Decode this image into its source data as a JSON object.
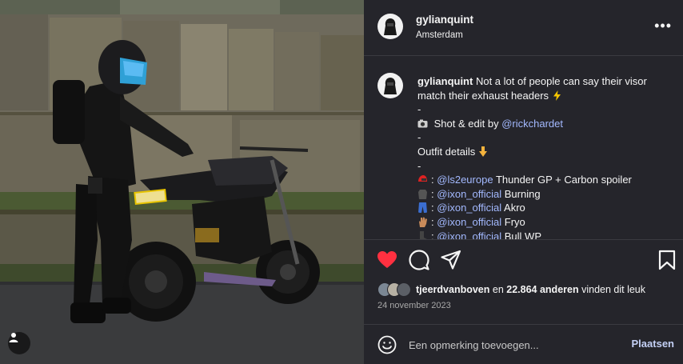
{
  "photo": {
    "user_tag_icon": "person-icon"
  },
  "header": {
    "username": "gylianquint",
    "location": "Amsterdam",
    "more_icon": "more-options-icon",
    "more_glyph": "•••"
  },
  "caption": {
    "username": "gylianquint",
    "text": "Not a lot of people can say their visor match their exhaust headers",
    "dash1": "-",
    "shot_text": "Shot & edit by",
    "shot_mention": "@rickchardet",
    "dash2": "-",
    "outfit_text": "Outfit details",
    "dash3": "-",
    "items": [
      {
        "sep": ":",
        "mention": "@ls2europe",
        "text": "Thunder GP + Carbon spoiler"
      },
      {
        "sep": ":",
        "mention": "@ixon_official",
        "text": "Burning"
      },
      {
        "sep": ":",
        "mention": "@ixon_official",
        "text": "Akro"
      },
      {
        "sep": ":",
        "mention": "@ixon_official",
        "text": "Fryo"
      },
      {
        "sep": ":",
        "mention": "@ixon_official",
        "text": "Bull WP"
      }
    ]
  },
  "actions": {
    "like_icon": "heart-icon",
    "comment_icon": "comment-icon",
    "share_icon": "share-icon",
    "save_icon": "bookmark-icon",
    "like_color": "#ff3040"
  },
  "likes": {
    "first_user": "tjeerdvanboven",
    "connector": "en",
    "others": "22.864 anderen",
    "suffix": "vinden dit leuk"
  },
  "date": "24 november 2023",
  "comment": {
    "emoji_icon": "emoji-icon",
    "placeholder": "Een opmerking toevoegen...",
    "post_label": "Plaatsen"
  },
  "colors": {
    "panel_bg": "#25252b",
    "link": "#a3b9ff",
    "post_button": "#c4d0f5"
  }
}
